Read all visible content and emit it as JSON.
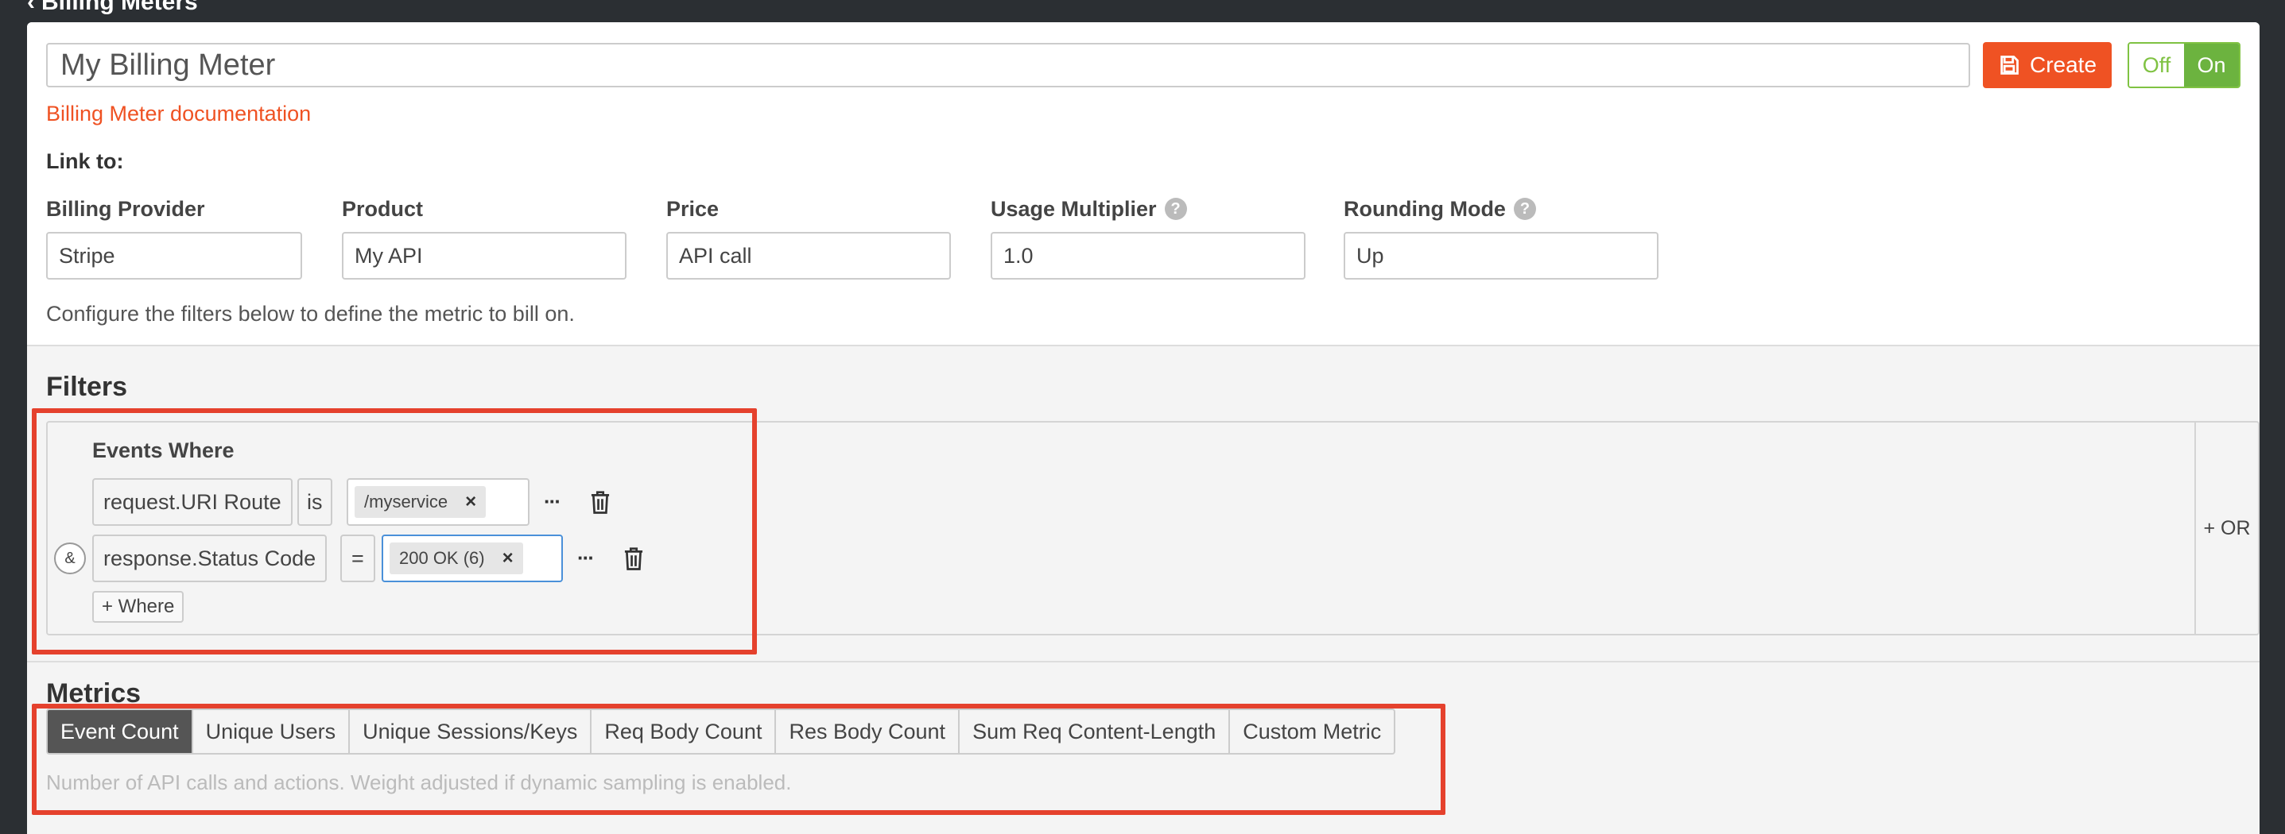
{
  "breadcrumb": {
    "label": "Billing Meters"
  },
  "meter": {
    "name": "My Billing Meter",
    "create_label": "Create",
    "toggle_off": "Off",
    "toggle_on": "On",
    "doc_link": "Billing Meter documentation"
  },
  "link_to": {
    "title": "Link to:",
    "fields": [
      {
        "label": "Billing Provider",
        "value": "Stripe"
      },
      {
        "label": "Product",
        "value": "My API"
      },
      {
        "label": "Price",
        "value": "API call"
      },
      {
        "label": "Usage Multiplier",
        "value": "1.0",
        "help": "?"
      },
      {
        "label": "Rounding Mode",
        "value": "Up",
        "help": "?"
      }
    ]
  },
  "configure_text": "Configure the filters below to define the metric to bill on.",
  "filters": {
    "title": "Filters",
    "events_where": "Events Where",
    "conditions": [
      {
        "field": "request.URI Route",
        "operator": "is",
        "value": "/myservice"
      },
      {
        "field": "response.Status Code",
        "operator": "=",
        "value": "200 OK (6)"
      }
    ],
    "and_label": "&",
    "add_where": "+ Where",
    "add_or": "+ OR",
    "more": "···",
    "remove_icon": "×"
  },
  "metrics": {
    "title": "Metrics",
    "tabs": [
      {
        "label": "Event Count",
        "active": true
      },
      {
        "label": "Unique Users"
      },
      {
        "label": "Unique Sessions/Keys"
      },
      {
        "label": "Req Body Count"
      },
      {
        "label": "Res Body Count"
      },
      {
        "label": "Sum Req Content-Length"
      },
      {
        "label": "Custom Metric"
      }
    ],
    "description": "Number of API calls and actions. Weight adjusted if dynamic sampling is enabled."
  },
  "colors": {
    "accent": "#ef5223",
    "toggle_green": "#6cb33f",
    "highlight": "#e5412d",
    "active_tab": "#555555"
  },
  "icons": [
    "chevron-left-icon",
    "save-icon",
    "help-icon",
    "more-icon",
    "trash-icon",
    "close-icon"
  ]
}
